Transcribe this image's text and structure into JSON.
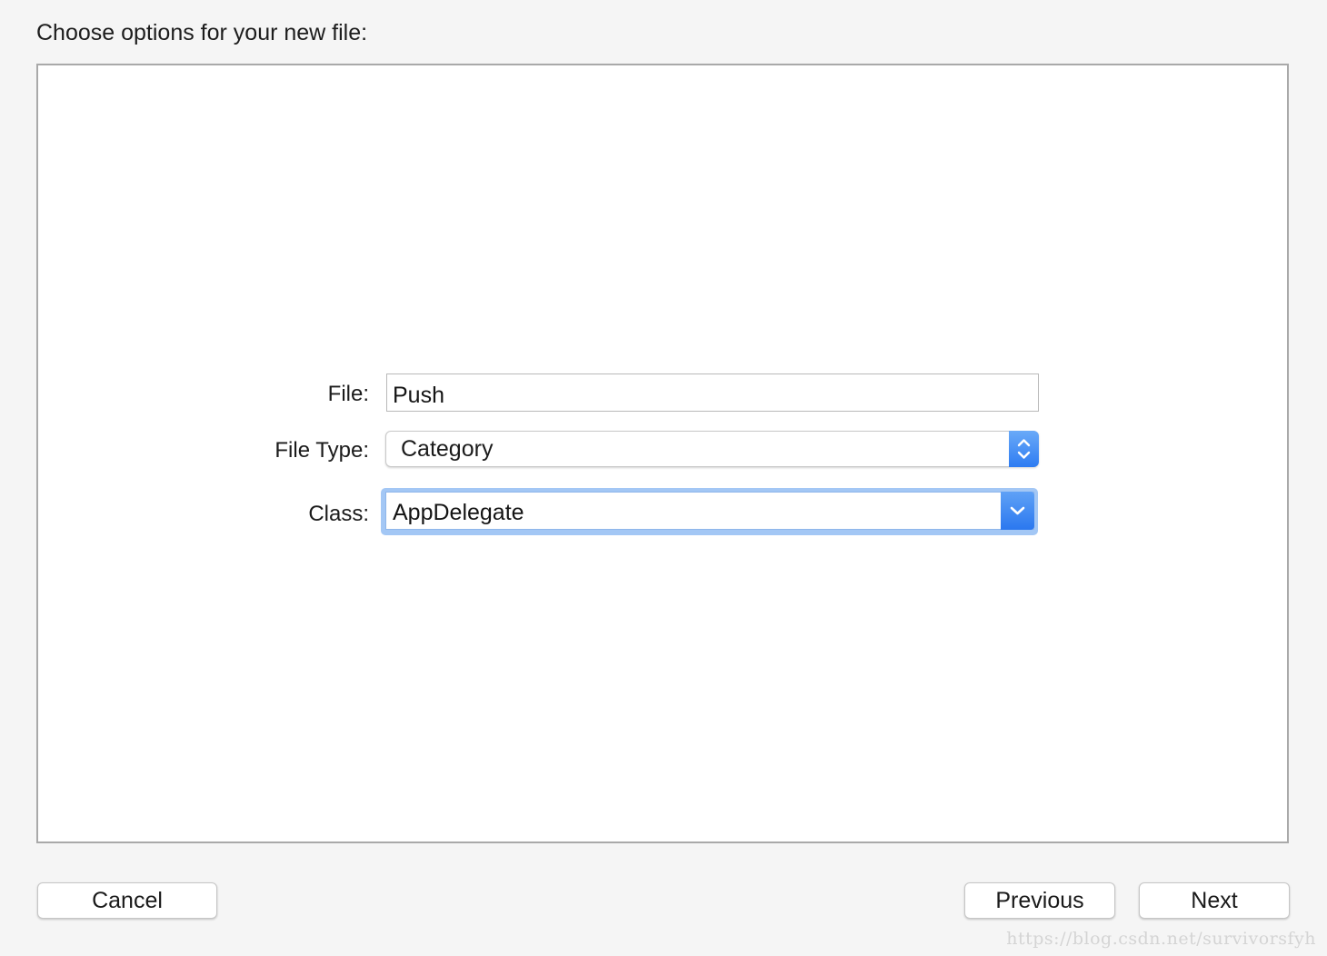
{
  "dialog": {
    "title": "Choose options for your new file:"
  },
  "form": {
    "file": {
      "label": "File:",
      "value": "Push"
    },
    "file_type": {
      "label": "File Type:",
      "value": "Category"
    },
    "class": {
      "label": "Class:",
      "value": "AppDelegate"
    }
  },
  "buttons": {
    "cancel": "Cancel",
    "previous": "Previous",
    "next": "Next"
  },
  "watermark": "https://blog.csdn.net/survivorsfyh",
  "colors": {
    "accent": "#3a86f4",
    "focus_ring": "#a3c7f5"
  },
  "icons": {
    "file_type_popup": "up-down-chevron-icon",
    "class_combo": "chevron-down-icon"
  }
}
